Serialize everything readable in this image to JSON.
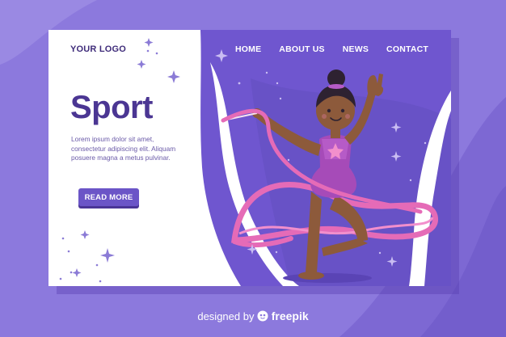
{
  "header": {
    "logo": "YOUR LOGO",
    "nav": [
      {
        "label": "HOME"
      },
      {
        "label": "ABOUT US"
      },
      {
        "label": "NEWS"
      },
      {
        "label": "CONTACT"
      }
    ]
  },
  "hero": {
    "title": "Sport",
    "body": "Lorem ipsum dolor sit amet, consectetur adipiscing elit. Aliquam posuere magna a metus pulvinar.",
    "cta_label": "READ MORE"
  },
  "footer": {
    "designed_by": "designed by",
    "brand": "freepik"
  },
  "colors": {
    "page_bg": "#8c79dd",
    "hero_panel": "#6f56cf",
    "title": "#4b3693",
    "button": "#6b55c7",
    "ribbon": "#e56bb7"
  },
  "icons": [
    "sparkle-icon",
    "freepik-logo-icon"
  ]
}
